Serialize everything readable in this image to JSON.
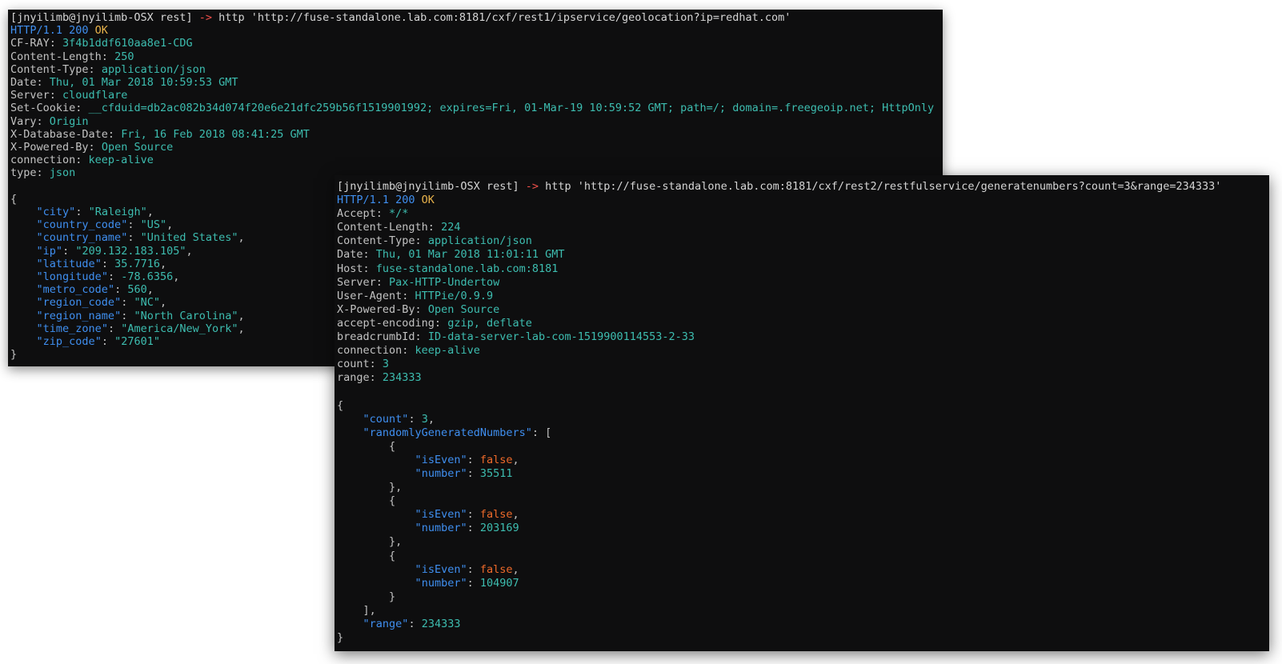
{
  "term1": {
    "prompt": "[jnyilimb@jnyilimb-OSX rest]",
    "arrow": "->",
    "command": "http 'http://fuse-standalone.lab.com:8181/cxf/rest1/ipservice/geolocation?ip=redhat.com'",
    "status": {
      "proto": "HTTP",
      "version": "/1.1 200 ",
      "text": "OK"
    },
    "headers": [
      {
        "k": "CF-RAY",
        "v": "3f4b1ddf610aa8e1-CDG"
      },
      {
        "k": "Content-Length",
        "v": "250"
      },
      {
        "k": "Content-Type",
        "v": "application/json"
      },
      {
        "k": "Date",
        "v": "Thu, 01 Mar 2018 10:59:53 GMT"
      },
      {
        "k": "Server",
        "v": "cloudflare"
      },
      {
        "k": "Set-Cookie",
        "v": "__cfduid=db2ac082b34d074f20e6e21dfc259b56f1519901992; expires=Fri, 01-Mar-19 10:59:52 GMT; path=/; domain=.freegeoip.net; HttpOnly"
      },
      {
        "k": "Vary",
        "v": "Origin"
      },
      {
        "k": "X-Database-Date",
        "v": "Fri, 16 Feb 2018 08:41:25 GMT"
      },
      {
        "k": "X-Powered-By",
        "v": "Open Source"
      },
      {
        "k": "connection",
        "v": "keep-alive"
      },
      {
        "k": "type",
        "v": "json"
      }
    ],
    "body": [
      {
        "k": "city",
        "v": "\"Raleigh\"",
        "t": "s"
      },
      {
        "k": "country_code",
        "v": "\"US\"",
        "t": "s"
      },
      {
        "k": "country_name",
        "v": "\"United States\"",
        "t": "s"
      },
      {
        "k": "ip",
        "v": "\"209.132.183.105\"",
        "t": "s"
      },
      {
        "k": "latitude",
        "v": "35.7716",
        "t": "n"
      },
      {
        "k": "longitude",
        "v": "-78.6356",
        "t": "n"
      },
      {
        "k": "metro_code",
        "v": "560",
        "t": "n"
      },
      {
        "k": "region_code",
        "v": "\"NC\"",
        "t": "s"
      },
      {
        "k": "region_name",
        "v": "\"North Carolina\"",
        "t": "s"
      },
      {
        "k": "time_zone",
        "v": "\"America/New_York\"",
        "t": "s"
      },
      {
        "k": "zip_code",
        "v": "\"27601\"",
        "t": "s"
      }
    ]
  },
  "term2": {
    "prompt": "[jnyilimb@jnyilimb-OSX rest]",
    "arrow": "->",
    "command": "http 'http://fuse-standalone.lab.com:8181/cxf/rest2/restfulservice/generatenumbers?count=3&range=234333'",
    "status": {
      "proto": "HTTP",
      "version": "/1.1 200 ",
      "text": "OK"
    },
    "headers": [
      {
        "k": "Accept",
        "v": "*/*"
      },
      {
        "k": "Content-Length",
        "v": "224"
      },
      {
        "k": "Content-Type",
        "v": "application/json"
      },
      {
        "k": "Date",
        "v": "Thu, 01 Mar 2018 11:01:11 GMT"
      },
      {
        "k": "Host",
        "v": "fuse-standalone.lab.com:8181"
      },
      {
        "k": "Server",
        "v": "Pax-HTTP-Undertow"
      },
      {
        "k": "User-Agent",
        "v": "HTTPie/0.9.9"
      },
      {
        "k": "X-Powered-By",
        "v": "Open Source"
      },
      {
        "k": "accept-encoding",
        "v": "gzip, deflate"
      },
      {
        "k": "breadcrumbId",
        "v": "ID-data-server-lab-com-1519900114553-2-33"
      },
      {
        "k": "connection",
        "v": "keep-alive"
      },
      {
        "k": "count",
        "v": "3"
      },
      {
        "k": "range",
        "v": "234333"
      }
    ],
    "body": {
      "count_key": "count",
      "count_val": "3",
      "list_key": "randomlyGeneratedNumbers",
      "items": [
        {
          "k1": "isEven",
          "v1": "false",
          "k2": "number",
          "v2": "35511"
        },
        {
          "k1": "isEven",
          "v1": "false",
          "k2": "number",
          "v2": "203169"
        },
        {
          "k1": "isEven",
          "v1": "false",
          "k2": "number",
          "v2": "104907"
        }
      ],
      "range_key": "range",
      "range_val": "234333"
    }
  }
}
